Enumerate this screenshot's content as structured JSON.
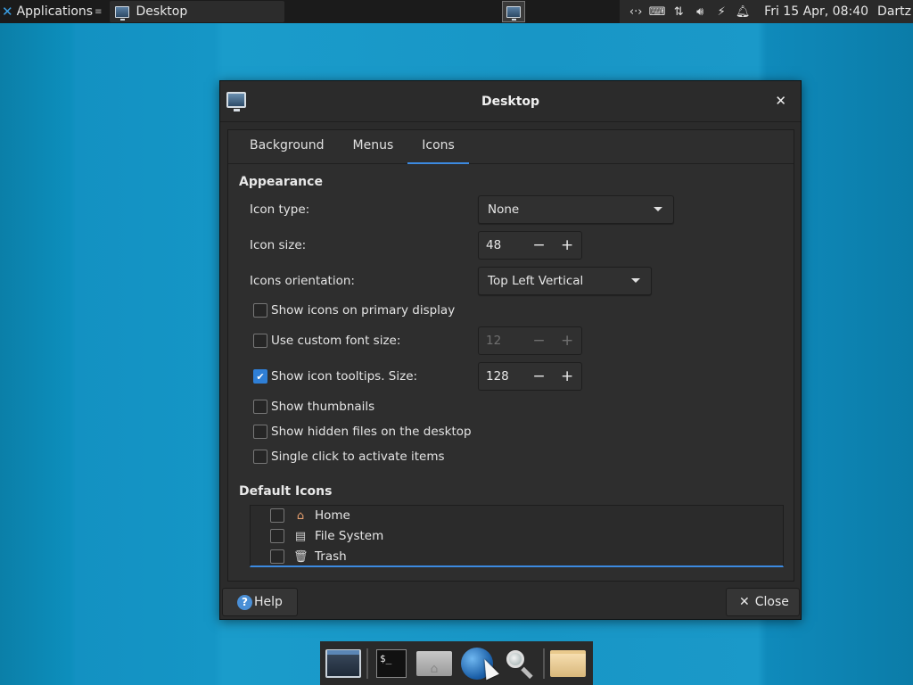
{
  "top_panel": {
    "applications_label": "Applications",
    "task_label": "Desktop",
    "clock": "Fri 15 Apr, 08:40",
    "user": "Dartz",
    "tray_icons": [
      "network-arrows-icon",
      "keyboard-icon",
      "transfer-icon",
      "volume-icon",
      "power-icon",
      "bell-icon"
    ]
  },
  "dialog": {
    "title": "Desktop",
    "tabs": [
      {
        "label": "Background",
        "active": false
      },
      {
        "label": "Menus",
        "active": false
      },
      {
        "label": "Icons",
        "active": true
      }
    ],
    "appearance": {
      "section_title": "Appearance",
      "icon_type_label": "Icon type:",
      "icon_type_value": "None",
      "icon_size_label": "Icon size:",
      "icon_size_value": "48",
      "orientation_label": "Icons orientation:",
      "orientation_value": "Top Left Vertical",
      "show_primary_label": "Show icons on primary display",
      "custom_font_label": "Use custom font size:",
      "custom_font_value": "12",
      "tooltips_label": "Show icon tooltips. Size:",
      "tooltips_value": "128",
      "thumbnails_label": "Show thumbnails",
      "hidden_files_label": "Show hidden files on the desktop",
      "single_click_label": "Single click to activate items"
    },
    "default_icons": {
      "section_title": "Default Icons",
      "items": [
        {
          "label": "Home",
          "icon": "home-icon"
        },
        {
          "label": "File System",
          "icon": "drive-icon"
        },
        {
          "label": "Trash",
          "icon": "trash-icon"
        }
      ]
    },
    "help_label": "Help",
    "close_label": "Close",
    "spin_minus": "−",
    "spin_plus": "+"
  },
  "colors": {
    "accent": "#3c8ae0",
    "desktop_bg": "#1596c6",
    "dialog_bg": "#2b2b2b"
  }
}
